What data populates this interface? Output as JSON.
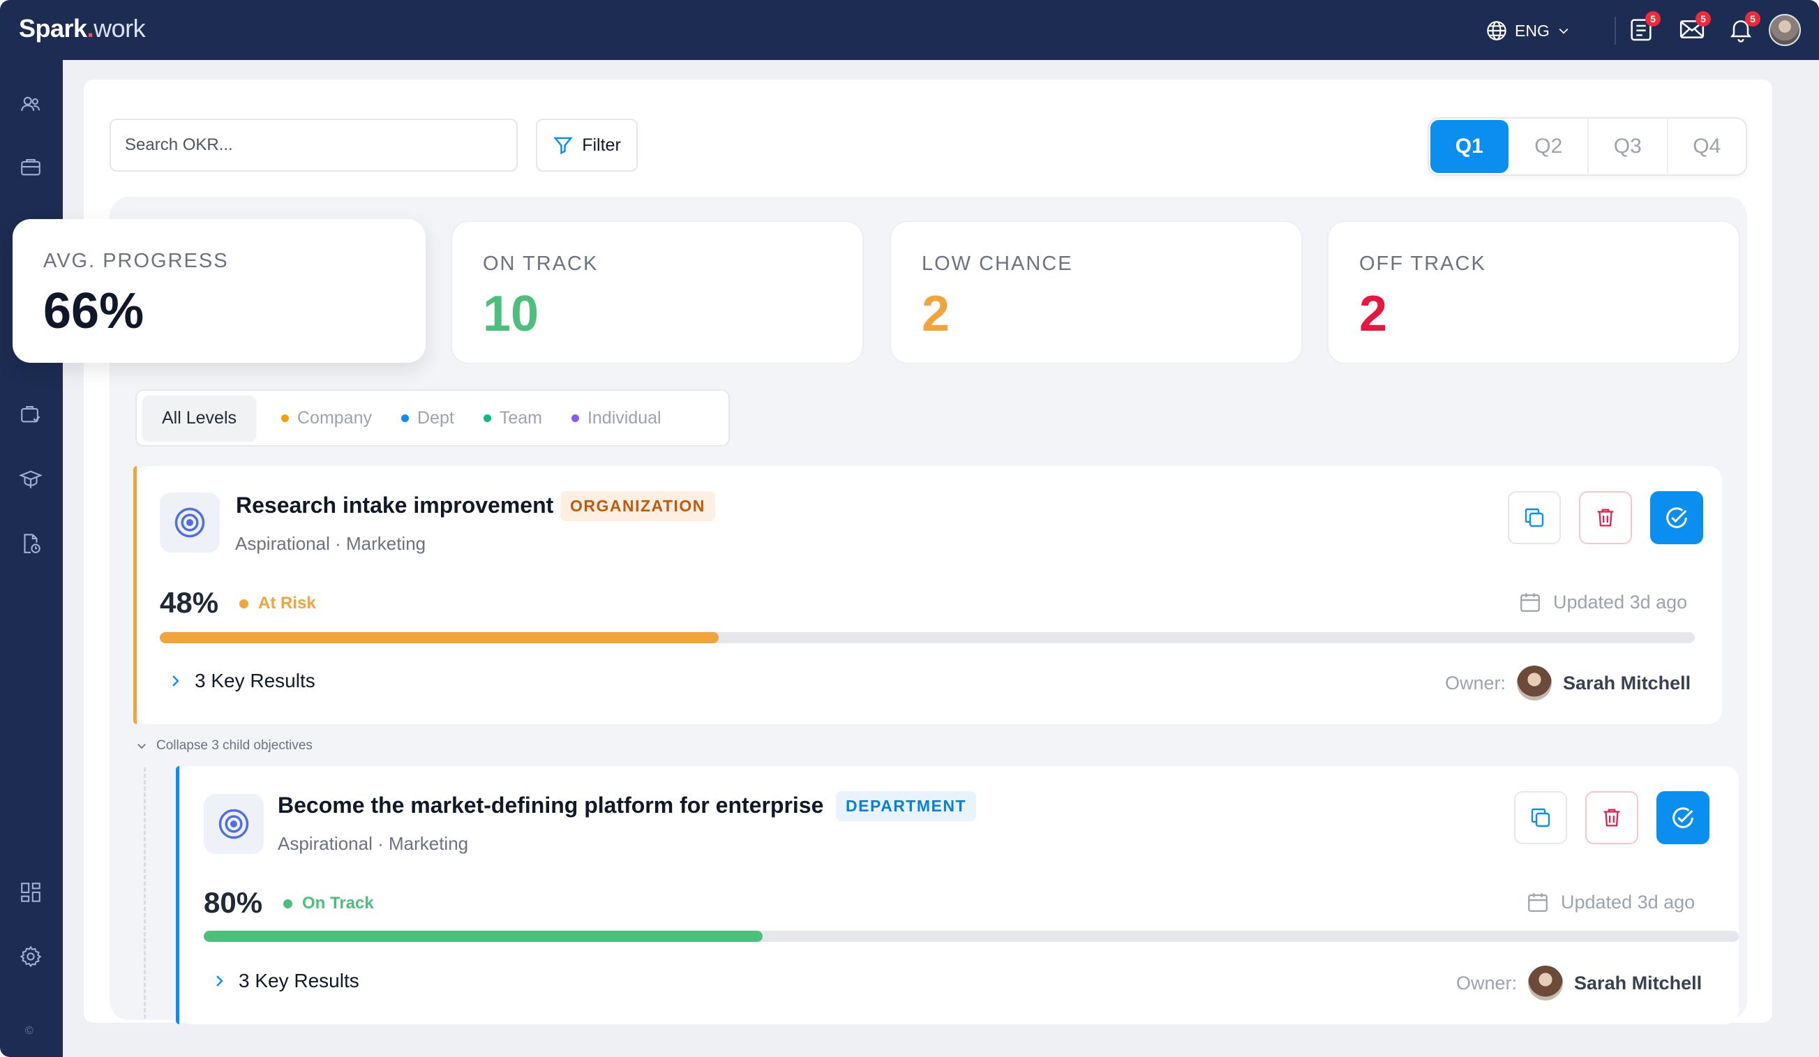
{
  "app": {
    "logo_bold": "Spark",
    "logo_dot": ".",
    "logo_light": "work",
    "language": "ENG",
    "badges": {
      "tasks": "5",
      "mail": "5",
      "notifications": "5"
    }
  },
  "toolbar": {
    "search_placeholder": "Search OKR...",
    "filter_label": "Filter",
    "quarters": [
      "Q1",
      "Q2",
      "Q3",
      "Q4"
    ],
    "active_quarter": "Q1"
  },
  "stats": [
    {
      "label": "AVG. PROGRESS",
      "value": "66%",
      "color": "#0f172a"
    },
    {
      "label": "ON TRACK",
      "value": "10",
      "color": "#4cbf7c"
    },
    {
      "label": "LOW CHANCE",
      "value": "2",
      "color": "#f0a43a"
    },
    {
      "label": "OFF TRACK",
      "value": "2",
      "color": "#e8173f"
    }
  ],
  "levels": [
    {
      "label": "All Levels",
      "dot": null
    },
    {
      "label": "Company",
      "dot": "#f59e0b"
    },
    {
      "label": "Dept",
      "dot": "#0a8ff0"
    },
    {
      "label": "Team",
      "dot": "#10b981"
    },
    {
      "label": "Individual",
      "dot": "#8b5cf6"
    }
  ],
  "okrs": [
    {
      "title": "Research intake improvement",
      "tag": "ORGANIZATION",
      "meta": "Aspirational · Marketing",
      "progress_label": "48%",
      "progress": 0.364,
      "status": "At Risk",
      "updated": "Updated 3d ago",
      "key_results": "3 Key Results",
      "owner_label": "Owner:",
      "owner_name": "Sarah Mitchell"
    },
    {
      "title": "Become the market-defining platform for enterprise",
      "tag": "DEPARTMENT",
      "meta": "Aspirational · Marketing",
      "progress_label": "80%",
      "progress": 0.364,
      "status": "On Track",
      "updated": "Updated 3d ago",
      "key_results": "3 Key Results",
      "owner_label": "Owner:",
      "owner_name": "Sarah Mitchell"
    }
  ],
  "collapse_label": "Collapse 3 child objectives",
  "sidebar_footer": "©",
  "colors": {
    "navy": "#1c2c52",
    "primary": "#0a8ff0",
    "at_risk": "#f0a43a",
    "on_track": "#4cbf7c",
    "org_tag_bg": "#fdf0e2",
    "org_tag_fg": "#c2590c",
    "dept_tag_bg": "#e8f3fd",
    "dept_tag_fg": "#0a7fd6"
  }
}
